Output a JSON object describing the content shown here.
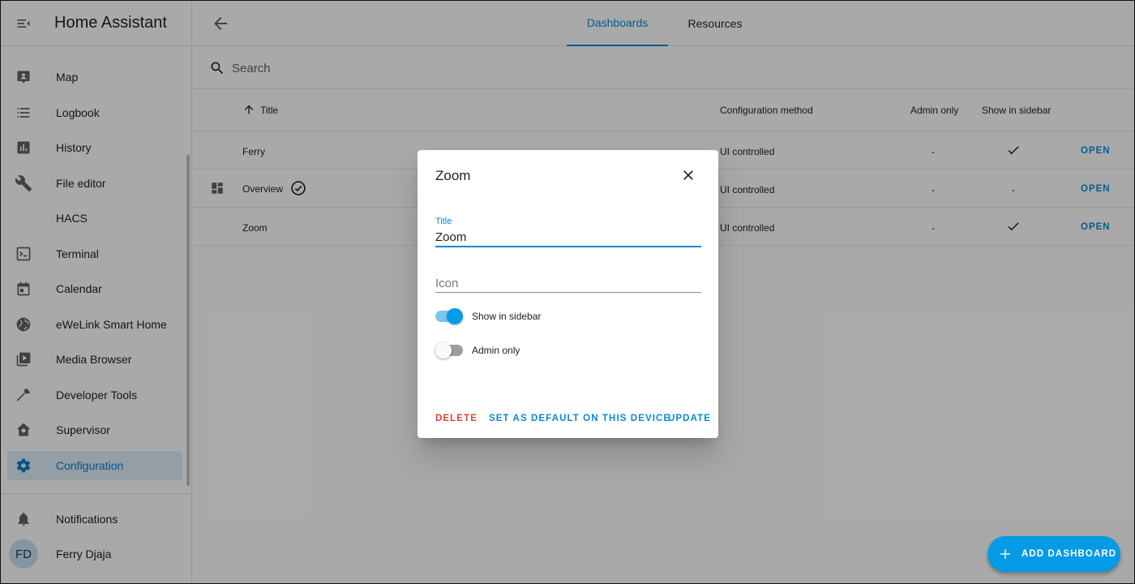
{
  "app": {
    "title": "Home Assistant"
  },
  "sidebar": {
    "items": [
      {
        "label": "Map",
        "icon": "map-icon"
      },
      {
        "label": "Logbook",
        "icon": "logbook-icon"
      },
      {
        "label": "History",
        "icon": "history-icon"
      },
      {
        "label": "File editor",
        "icon": "wrench-icon"
      },
      {
        "label": "HACS",
        "icon": ""
      },
      {
        "label": "Terminal",
        "icon": "terminal-icon"
      },
      {
        "label": "Calendar",
        "icon": "calendar-icon"
      },
      {
        "label": "eWeLink Smart Home",
        "icon": "globe-icon"
      },
      {
        "label": "Media Browser",
        "icon": "media-icon"
      },
      {
        "label": "Developer Tools",
        "icon": "hammer-icon"
      },
      {
        "label": "Supervisor",
        "icon": "supervisor-icon"
      },
      {
        "label": "Configuration",
        "icon": "gear-icon",
        "active": true
      }
    ],
    "notifications_label": "Notifications",
    "user": {
      "initials": "FD",
      "name": "Ferry Djaja"
    }
  },
  "topbar": {
    "tabs": [
      {
        "label": "Dashboards",
        "active": true
      },
      {
        "label": "Resources",
        "active": false
      }
    ]
  },
  "search": {
    "placeholder": "Search"
  },
  "table": {
    "headers": {
      "title": "Title",
      "config_method": "Configuration method",
      "admin_only": "Admin only",
      "show_in_sidebar": "Show in sidebar"
    },
    "rows": [
      {
        "title": "Ferry",
        "config_method": "UI controlled",
        "admin_only": "-",
        "show_in_sidebar": "check",
        "action": "OPEN"
      },
      {
        "title": "Overview",
        "config_method": "UI controlled",
        "admin_only": "-",
        "show_in_sidebar": "-",
        "action": "OPEN",
        "default": true
      },
      {
        "title": "Zoom",
        "config_method": "UI controlled",
        "admin_only": "-",
        "show_in_sidebar": "check",
        "action": "OPEN"
      }
    ]
  },
  "dialog": {
    "title": "Zoom",
    "title_field_label": "Title",
    "title_field_value": "Zoom",
    "icon_field_placeholder": "Icon",
    "show_in_sidebar_label": "Show in sidebar",
    "show_in_sidebar": true,
    "admin_only_label": "Admin only",
    "admin_only": false,
    "delete_label": "DELETE",
    "set_default_label": "SET AS DEFAULT ON THIS DEVICE",
    "update_label": "UPDATE"
  },
  "fab": {
    "label": "ADD DASHBOARD"
  },
  "colors": {
    "accent": "#039be5",
    "link": "#0a88d6",
    "danger": "#db4437",
    "overlay": "rgba(0,0,0,0.32)"
  }
}
